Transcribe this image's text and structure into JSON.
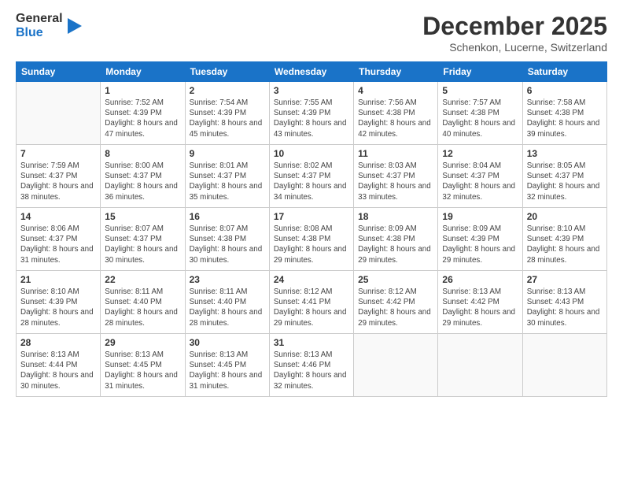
{
  "header": {
    "logo_general": "General",
    "logo_blue": "Blue",
    "title": "December 2025",
    "subtitle": "Schenkon, Lucerne, Switzerland"
  },
  "days_of_week": [
    "Sunday",
    "Monday",
    "Tuesday",
    "Wednesday",
    "Thursday",
    "Friday",
    "Saturday"
  ],
  "weeks": [
    [
      {
        "day": "",
        "sunrise": "",
        "sunset": "",
        "daylight": ""
      },
      {
        "day": "1",
        "sunrise": "Sunrise: 7:52 AM",
        "sunset": "Sunset: 4:39 PM",
        "daylight": "Daylight: 8 hours and 47 minutes."
      },
      {
        "day": "2",
        "sunrise": "Sunrise: 7:54 AM",
        "sunset": "Sunset: 4:39 PM",
        "daylight": "Daylight: 8 hours and 45 minutes."
      },
      {
        "day": "3",
        "sunrise": "Sunrise: 7:55 AM",
        "sunset": "Sunset: 4:39 PM",
        "daylight": "Daylight: 8 hours and 43 minutes."
      },
      {
        "day": "4",
        "sunrise": "Sunrise: 7:56 AM",
        "sunset": "Sunset: 4:38 PM",
        "daylight": "Daylight: 8 hours and 42 minutes."
      },
      {
        "day": "5",
        "sunrise": "Sunrise: 7:57 AM",
        "sunset": "Sunset: 4:38 PM",
        "daylight": "Daylight: 8 hours and 40 minutes."
      },
      {
        "day": "6",
        "sunrise": "Sunrise: 7:58 AM",
        "sunset": "Sunset: 4:38 PM",
        "daylight": "Daylight: 8 hours and 39 minutes."
      }
    ],
    [
      {
        "day": "7",
        "sunrise": "Sunrise: 7:59 AM",
        "sunset": "Sunset: 4:37 PM",
        "daylight": "Daylight: 8 hours and 38 minutes."
      },
      {
        "day": "8",
        "sunrise": "Sunrise: 8:00 AM",
        "sunset": "Sunset: 4:37 PM",
        "daylight": "Daylight: 8 hours and 36 minutes."
      },
      {
        "day": "9",
        "sunrise": "Sunrise: 8:01 AM",
        "sunset": "Sunset: 4:37 PM",
        "daylight": "Daylight: 8 hours and 35 minutes."
      },
      {
        "day": "10",
        "sunrise": "Sunrise: 8:02 AM",
        "sunset": "Sunset: 4:37 PM",
        "daylight": "Daylight: 8 hours and 34 minutes."
      },
      {
        "day": "11",
        "sunrise": "Sunrise: 8:03 AM",
        "sunset": "Sunset: 4:37 PM",
        "daylight": "Daylight: 8 hours and 33 minutes."
      },
      {
        "day": "12",
        "sunrise": "Sunrise: 8:04 AM",
        "sunset": "Sunset: 4:37 PM",
        "daylight": "Daylight: 8 hours and 32 minutes."
      },
      {
        "day": "13",
        "sunrise": "Sunrise: 8:05 AM",
        "sunset": "Sunset: 4:37 PM",
        "daylight": "Daylight: 8 hours and 32 minutes."
      }
    ],
    [
      {
        "day": "14",
        "sunrise": "Sunrise: 8:06 AM",
        "sunset": "Sunset: 4:37 PM",
        "daylight": "Daylight: 8 hours and 31 minutes."
      },
      {
        "day": "15",
        "sunrise": "Sunrise: 8:07 AM",
        "sunset": "Sunset: 4:37 PM",
        "daylight": "Daylight: 8 hours and 30 minutes."
      },
      {
        "day": "16",
        "sunrise": "Sunrise: 8:07 AM",
        "sunset": "Sunset: 4:38 PM",
        "daylight": "Daylight: 8 hours and 30 minutes."
      },
      {
        "day": "17",
        "sunrise": "Sunrise: 8:08 AM",
        "sunset": "Sunset: 4:38 PM",
        "daylight": "Daylight: 8 hours and 29 minutes."
      },
      {
        "day": "18",
        "sunrise": "Sunrise: 8:09 AM",
        "sunset": "Sunset: 4:38 PM",
        "daylight": "Daylight: 8 hours and 29 minutes."
      },
      {
        "day": "19",
        "sunrise": "Sunrise: 8:09 AM",
        "sunset": "Sunset: 4:39 PM",
        "daylight": "Daylight: 8 hours and 29 minutes."
      },
      {
        "day": "20",
        "sunrise": "Sunrise: 8:10 AM",
        "sunset": "Sunset: 4:39 PM",
        "daylight": "Daylight: 8 hours and 28 minutes."
      }
    ],
    [
      {
        "day": "21",
        "sunrise": "Sunrise: 8:10 AM",
        "sunset": "Sunset: 4:39 PM",
        "daylight": "Daylight: 8 hours and 28 minutes."
      },
      {
        "day": "22",
        "sunrise": "Sunrise: 8:11 AM",
        "sunset": "Sunset: 4:40 PM",
        "daylight": "Daylight: 8 hours and 28 minutes."
      },
      {
        "day": "23",
        "sunrise": "Sunrise: 8:11 AM",
        "sunset": "Sunset: 4:40 PM",
        "daylight": "Daylight: 8 hours and 28 minutes."
      },
      {
        "day": "24",
        "sunrise": "Sunrise: 8:12 AM",
        "sunset": "Sunset: 4:41 PM",
        "daylight": "Daylight: 8 hours and 29 minutes."
      },
      {
        "day": "25",
        "sunrise": "Sunrise: 8:12 AM",
        "sunset": "Sunset: 4:42 PM",
        "daylight": "Daylight: 8 hours and 29 minutes."
      },
      {
        "day": "26",
        "sunrise": "Sunrise: 8:13 AM",
        "sunset": "Sunset: 4:42 PM",
        "daylight": "Daylight: 8 hours and 29 minutes."
      },
      {
        "day": "27",
        "sunrise": "Sunrise: 8:13 AM",
        "sunset": "Sunset: 4:43 PM",
        "daylight": "Daylight: 8 hours and 30 minutes."
      }
    ],
    [
      {
        "day": "28",
        "sunrise": "Sunrise: 8:13 AM",
        "sunset": "Sunset: 4:44 PM",
        "daylight": "Daylight: 8 hours and 30 minutes."
      },
      {
        "day": "29",
        "sunrise": "Sunrise: 8:13 AM",
        "sunset": "Sunset: 4:45 PM",
        "daylight": "Daylight: 8 hours and 31 minutes."
      },
      {
        "day": "30",
        "sunrise": "Sunrise: 8:13 AM",
        "sunset": "Sunset: 4:45 PM",
        "daylight": "Daylight: 8 hours and 31 minutes."
      },
      {
        "day": "31",
        "sunrise": "Sunrise: 8:13 AM",
        "sunset": "Sunset: 4:46 PM",
        "daylight": "Daylight: 8 hours and 32 minutes."
      },
      {
        "day": "",
        "sunrise": "",
        "sunset": "",
        "daylight": ""
      },
      {
        "day": "",
        "sunrise": "",
        "sunset": "",
        "daylight": ""
      },
      {
        "day": "",
        "sunrise": "",
        "sunset": "",
        "daylight": ""
      }
    ]
  ]
}
